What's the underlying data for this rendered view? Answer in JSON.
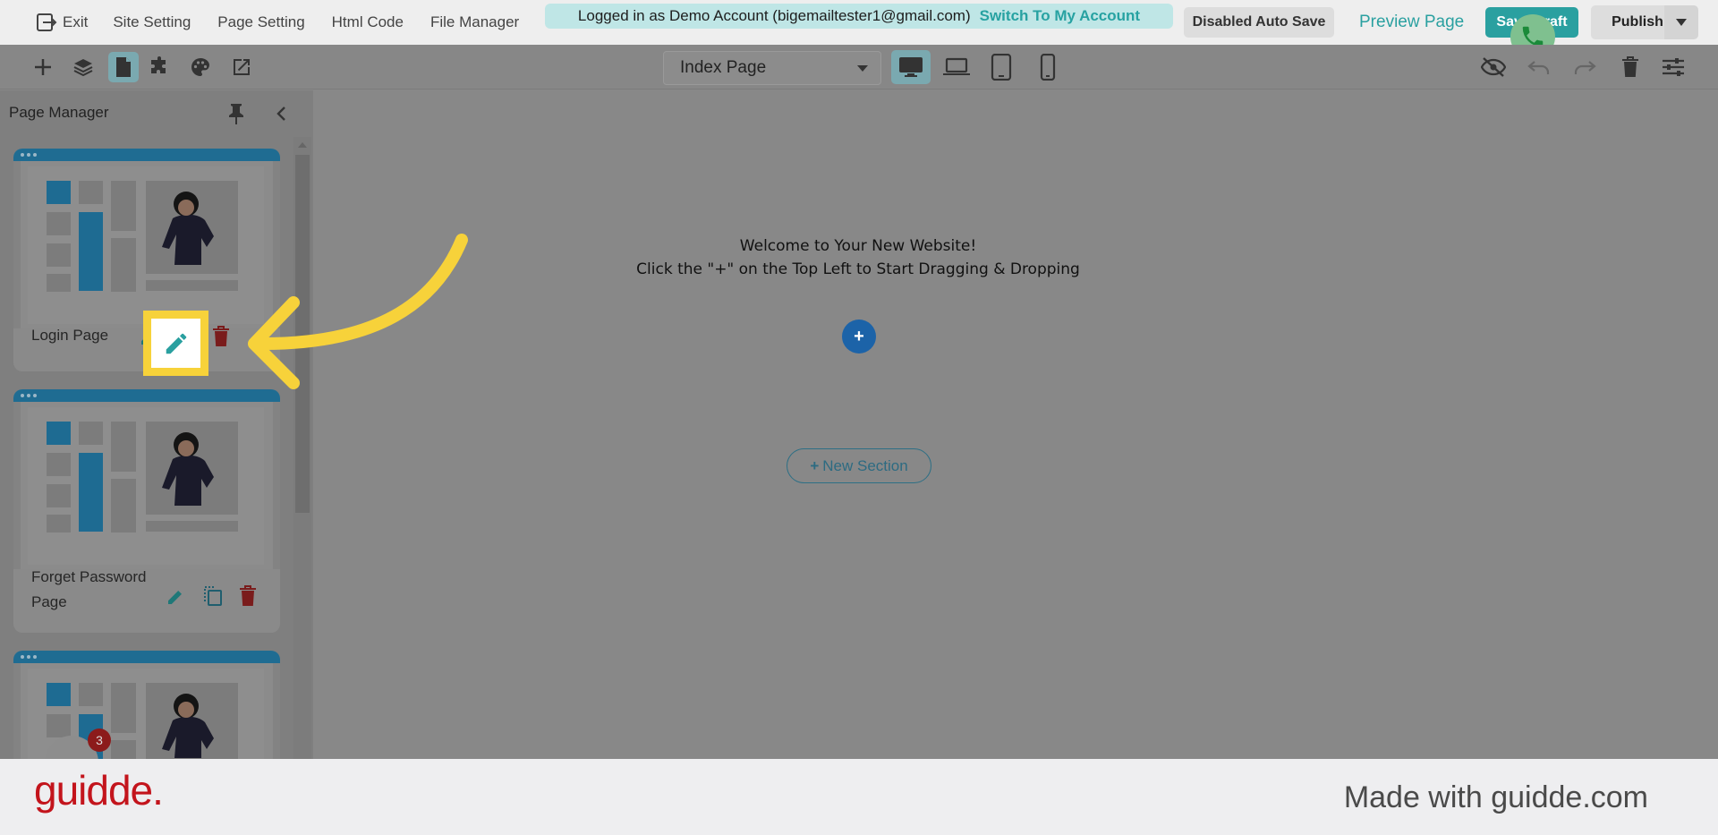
{
  "menu": {
    "exit": "Exit",
    "site_setting": "Site Setting",
    "page_setting": "Page Setting",
    "html_code": "Html Code",
    "file_manager": "File Manager"
  },
  "banner": {
    "text": "Logged in as Demo Account (bigemailtester1@gmail.com)",
    "switch": "Switch To My Account"
  },
  "actions": {
    "autosave": "Disabled Auto Save",
    "preview": "Preview Page",
    "save": "Save Draft",
    "publish": "Publish"
  },
  "page_select": {
    "value": "Index Page"
  },
  "sidebar": {
    "title": "Page Manager",
    "pages": [
      {
        "label": "Login Page"
      },
      {
        "label": "Forget Password Page"
      },
      {
        "label": ""
      }
    ]
  },
  "canvas": {
    "line1": "Welcome to Your New Website!",
    "line2": "Click the \"+\" on the Top Left to Start Dragging & Dropping",
    "add": "+",
    "new_section": "New Section",
    "new_section_plus": "+"
  },
  "chat": {
    "badge": "3"
  },
  "footer": {
    "logo": "guidde.",
    "credit": "Made with guidde.com"
  },
  "colors": {
    "accent": "#2aa0a0",
    "highlight": "#f7d23a",
    "delete": "#c62828",
    "brand_red": "#c3141c"
  }
}
